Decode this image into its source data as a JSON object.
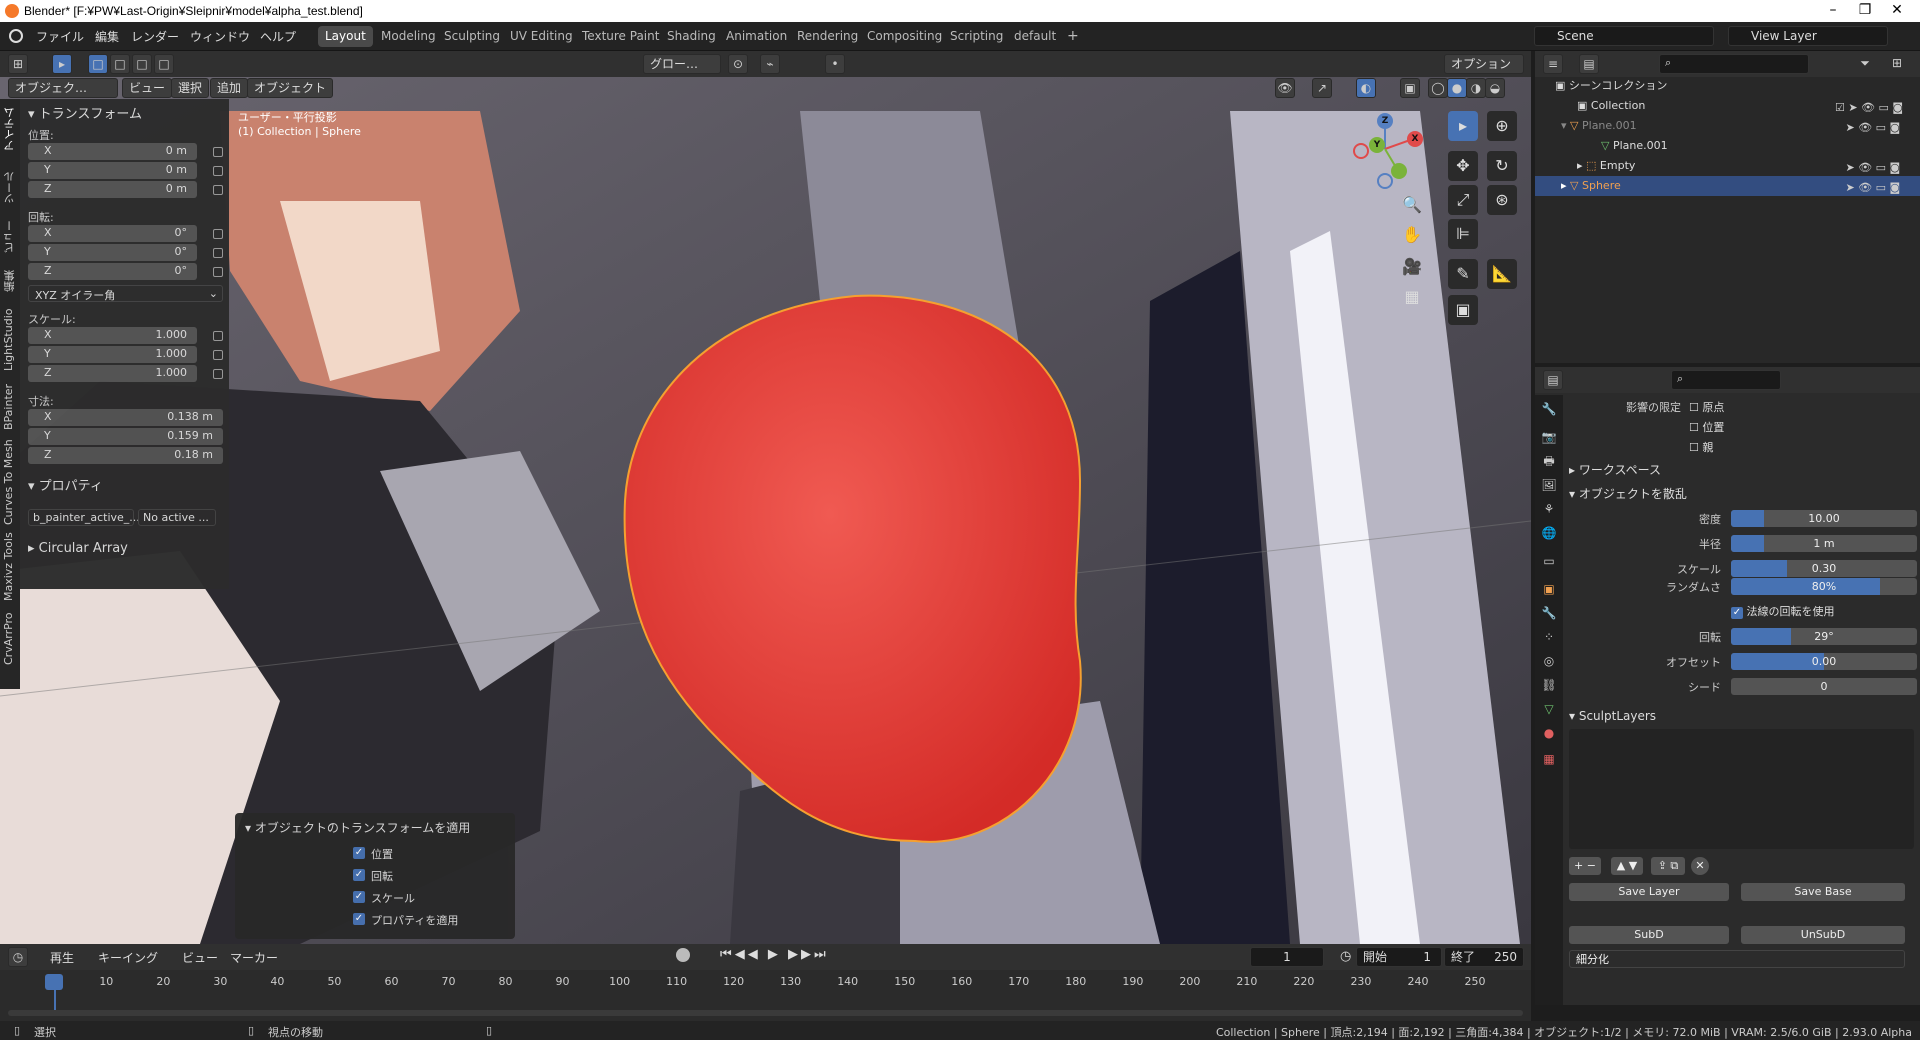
{
  "window": {
    "title": "Blender* [F:¥PW¥Last-Origin¥Sleipnir¥model¥alpha_test.blend]",
    "min": "–",
    "max": "❐",
    "close": "✕"
  },
  "menu": [
    "ファイル",
    "編集",
    "レンダー",
    "ウィンドウ",
    "ヘルプ"
  ],
  "workspaces": [
    "Layout",
    "Modeling",
    "Sculpting",
    "UV Editing",
    "Texture Paint",
    "Shading",
    "Animation",
    "Rendering",
    "Compositing",
    "Scripting",
    "default"
  ],
  "active_workspace": "Layout",
  "add_workspace": "+",
  "scene": "Scene",
  "view_layer": "View Layer",
  "viewport": {
    "mode": "オブジェク…",
    "menus": [
      "ビュー",
      "選択",
      "追加",
      "オブジェクト"
    ],
    "transform_orient": "グロー…",
    "options": "オプション",
    "view_label": "ユーザー・平行投影",
    "collection_label": "(1) Collection | Sphere",
    "gizmo": {
      "x": "X",
      "y": "Y",
      "z": "Z"
    }
  },
  "npanel": {
    "tabs": [
      "アイテム",
      "ツール",
      "ビュー",
      "編集",
      "LightStudio",
      "BPainter",
      "Curves To Mesh",
      "Maxivz Tools",
      "CrvArrPro"
    ],
    "transform": "トランスフォーム",
    "location": "位置:",
    "loc": [
      {
        "a": "X",
        "v": "0 m"
      },
      {
        "a": "Y",
        "v": "0 m"
      },
      {
        "a": "Z",
        "v": "0 m"
      }
    ],
    "rotation": "回転:",
    "rot": [
      {
        "a": "X",
        "v": "0°"
      },
      {
        "a": "Y",
        "v": "0°"
      },
      {
        "a": "Z",
        "v": "0°"
      }
    ],
    "rot_mode": "XYZ オイラー角",
    "scale": "スケール:",
    "sca": [
      {
        "a": "X",
        "v": "1.000"
      },
      {
        "a": "Y",
        "v": "1.000"
      },
      {
        "a": "Z",
        "v": "1.000"
      }
    ],
    "dimensions": "寸法:",
    "dim": [
      {
        "a": "X",
        "v": "0.138 m"
      },
      {
        "a": "Y",
        "v": "0.159 m"
      },
      {
        "a": "Z",
        "v": "0.18 m"
      }
    ],
    "properties": "プロパティ",
    "prop_name": "b_painter_active_...",
    "prop_value": "No active ...",
    "circular_array": "Circular Array"
  },
  "apply_panel": {
    "title": "オブジェクトのトランスフォームを適用",
    "items": [
      "位置",
      "回転",
      "スケール",
      "プロパティを適用"
    ]
  },
  "outliner": {
    "search_placeholder": "",
    "scene_collection": "シーンコレクション",
    "rows": [
      {
        "name": "Collection",
        "indent": 0
      },
      {
        "name": "Plane.001",
        "indent": 1
      },
      {
        "name": "Plane.001",
        "indent": 2
      },
      {
        "name": "Empty",
        "indent": 1
      },
      {
        "name": "Sphere",
        "indent": 1
      }
    ]
  },
  "properties": {
    "influence": "影響の限定",
    "influence_opts": [
      "原点",
      "位置",
      "親"
    ],
    "workspace": "ワークスペース",
    "scatter": "オブジェクトを散乱",
    "fields": [
      {
        "label": "密度",
        "value": "10.00",
        "fill": 0.18
      },
      {
        "label": "半径",
        "value": "1 m",
        "fill": 0.18
      },
      {
        "label": "スケール",
        "value": "0.30",
        "fill": 0.3
      },
      {
        "label": "ランダムさ",
        "value": "80%",
        "fill": 0.8
      }
    ],
    "use_normal": "法線の回転を使用",
    "fields2": [
      {
        "label": "回転",
        "value": "29°",
        "fill": 0.32
      },
      {
        "label": "オフセット",
        "value": "0.00",
        "fill": 0.5
      },
      {
        "label": "シード",
        "value": "0",
        "fill": 0
      }
    ],
    "sculpt_layers": "SculptLayers",
    "save_layer": "Save Layer",
    "save_base": "Save Base",
    "subd": "SubD",
    "unsubd": "UnSubD",
    "subdivide": "細分化"
  },
  "timeline": {
    "menus": [
      "再生",
      "キーイング",
      "ビュー",
      "マーカー"
    ],
    "current_frame": "1",
    "start_label": "開始",
    "start": "1",
    "end_label": "終了",
    "end": "250",
    "ticks": [
      "1",
      "10",
      "20",
      "30",
      "40",
      "50",
      "60",
      "70",
      "80",
      "90",
      "100",
      "110",
      "120",
      "130",
      "140",
      "150",
      "160",
      "170",
      "180",
      "190",
      "200",
      "210",
      "220",
      "230",
      "240",
      "250"
    ]
  },
  "status": {
    "select": "選択",
    "move": "視点の移動",
    "info": "Collection | Sphere | 頂点:2,194 | 面:2,192 | 三角面:4,384 | オブジェクト:1/2 | メモリ: 72.0 MiB | VRAM: 2.5/6.0 GiB | 2.93.0 Alpha"
  },
  "colors": {
    "accent": "#4772b3",
    "sphere": "#e23a36",
    "outline": "#f5a030"
  }
}
